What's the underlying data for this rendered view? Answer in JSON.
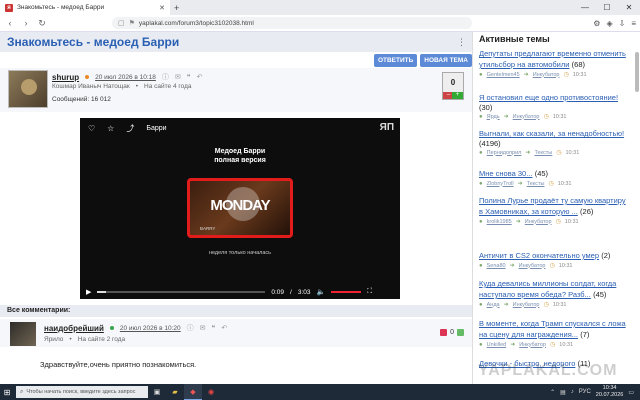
{
  "browser": {
    "tab_title": "Знакомьтесь - медоед Барри",
    "url": "yaplakal.com/forum3/topic3102038.html",
    "win_min": "—",
    "win_max": "☐",
    "win_close": "✕"
  },
  "topic": {
    "title": "Знакомьтесь - медоед Барри",
    "reply_button": "ОТВЕТИТЬ",
    "new_topic_button": "НОВАЯ ТЕМА"
  },
  "post": {
    "author": "shurup",
    "date": "20 июл 2026 в 10:18",
    "rank": "Кошмар Иваныч Натощак",
    "site_age": "На сайте 4 года",
    "messages": "Сообщений: 16 012",
    "rating": "0",
    "rating_minus": "–",
    "rating_plus": "+"
  },
  "video": {
    "channel": "Барри",
    "logo": "ЯП",
    "heading_line1": "Медоед Барри",
    "heading_line2": "полная версия",
    "card_text": "MONDAY",
    "card_sub": "BARRY",
    "caption": "неделя только началась",
    "time_current": "0:09",
    "time_separator": "/",
    "time_total": "3:03",
    "progress": 0.05
  },
  "comments": {
    "header": "Все комментарии:",
    "author": "наидобрейший",
    "date": "20 июл 2026 в 10:20",
    "location": "Ярило",
    "site_age": "На сайте 2 года",
    "rating": "0",
    "text": "Здравствуйте,очень приятно познакомиться."
  },
  "sidebar": {
    "title": "Активные темы",
    "items": [
      {
        "title": "Депутаты предлагают временно отменить утильсбор на автомобили",
        "count": "(68)",
        "author": "Gentelmen45",
        "section": "Инкубатор",
        "time": "10:31"
      },
      {
        "title": "Я остановил еще одно противостояние!",
        "count": "(30)",
        "author": "Ярдь",
        "section": "Инкубатор",
        "time": "10:31"
      },
      {
        "title": "Выгнали, как сказали, за ненадобностью!",
        "count": "(4196)",
        "author": "Пернидоприл",
        "section": "Тексты",
        "time": "10:31"
      },
      {
        "title": "Мне снова 30...",
        "count": "(45)",
        "author": "ZlobnyTroll",
        "section": "Тексты",
        "time": "10:31"
      },
      {
        "title": "Полина Лурье продаёт ту самую квартиру в Хамовниках, за которую ...",
        "count": "(26)",
        "author": "krolik1985",
        "section": "Инкубатор",
        "time": "10:31"
      },
      {
        "title": "Античит в CS2 окончательно умер",
        "count": "(2)",
        "author": "Sena80",
        "section": "Инкубатор",
        "time": "10:31"
      },
      {
        "title": "Куда девались миллионы солдат, когда наступало время обеда? Разб...",
        "count": "(45)",
        "author": "Анда",
        "section": "Инкубатор",
        "time": "10:31"
      },
      {
        "title": "В моменте, когда Трамп спускался с ложа на сцену для награждения...",
        "count": "(7)",
        "author": "Unkilled",
        "section": "Инкубатор",
        "time": "10:31"
      },
      {
        "title": "Девочки - быстро, недорого",
        "count": "(11)",
        "author": "",
        "section": "",
        "time": ""
      }
    ],
    "watermark": "YAPLAKAL.COM"
  },
  "taskbar": {
    "search_placeholder": "Чтобы начать поиск, введите здесь запрос",
    "lang": "РУС",
    "time": "10:34",
    "date": "20.07.2026"
  }
}
